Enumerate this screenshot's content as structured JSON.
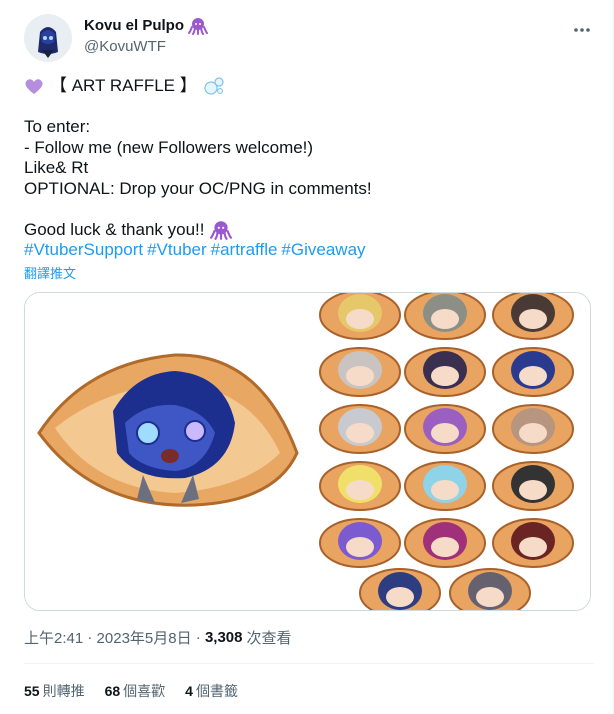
{
  "author": {
    "display_name": "Kovu el Pulpo",
    "handle": "@KovuWTF",
    "name_badge_icon": "octopus-emoji"
  },
  "tweet": {
    "line1_title": "【 ART RAFFLE 】",
    "line1_leading_icon": "purple-heart-emoji",
    "line1_trailing_icon": "bubbles-emoji",
    "line2": "To enter:",
    "line3": "- Follow me (new Followers welcome!)",
    "line4": "Like& Rt",
    "line5": "OPTIONAL: Drop your OC/PNG in comments!",
    "line6": "Good luck & thank you!!",
    "line6_icon": "octopus-emoji",
    "hashtags": [
      "#VtuberSupport",
      "#Vtuber",
      "#artraffle",
      "#Giveaway"
    ],
    "translate_label": "翻譯推文"
  },
  "media": {
    "description_icon": "art-raffle-image"
  },
  "meta": {
    "time": "上午2:41",
    "date": "2023年5月8日",
    "views_count": "3,308",
    "views_label": "次查看"
  },
  "stats": {
    "retweets_count": "55",
    "retweets_label": "則轉推",
    "likes_count": "68",
    "likes_label": "個喜歡",
    "bookmarks_count": "4",
    "bookmarks_label": "個書籤"
  },
  "colors": {
    "text": "#0f1419",
    "secondary": "#536471",
    "link": "#1d9bf0",
    "border": "#cfd9de"
  }
}
